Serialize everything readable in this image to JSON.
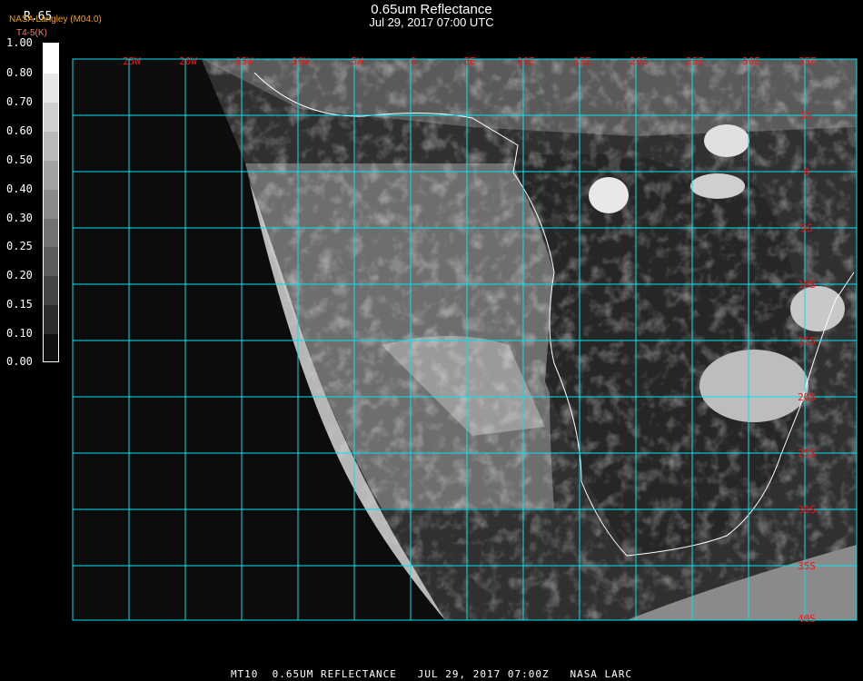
{
  "header": {
    "title": "0.65um Reflectance",
    "subtitle": "Jul 29, 2017 07:00 UTC",
    "source": "NASA Langley (M04.0)",
    "band": "R.65",
    "secondary": "T4-5(K)"
  },
  "colorbar": {
    "labels": [
      "1.00",
      "0.80",
      "0.70",
      "0.60",
      "0.50",
      "0.40",
      "0.30",
      "0.25",
      "0.20",
      "0.15",
      "0.10",
      "0.00"
    ]
  },
  "map": {
    "lon_labels": [
      "25W",
      "20W",
      "15W",
      "10W",
      "5W",
      "0",
      "5E",
      "10E",
      "15E",
      "20E",
      "25E",
      "30E",
      "35E"
    ],
    "lat_labels": [
      "5N",
      "0",
      "5S",
      "10S",
      "15S",
      "20S",
      "25S",
      "30S",
      "35S",
      "40S"
    ],
    "grid_color": "#00e5ee",
    "label_color": "#ff1010"
  },
  "footer": {
    "text": "MT10  0.65UM REFLECTANCE   JUL 29, 2017 07:00Z   NASA LARC"
  }
}
